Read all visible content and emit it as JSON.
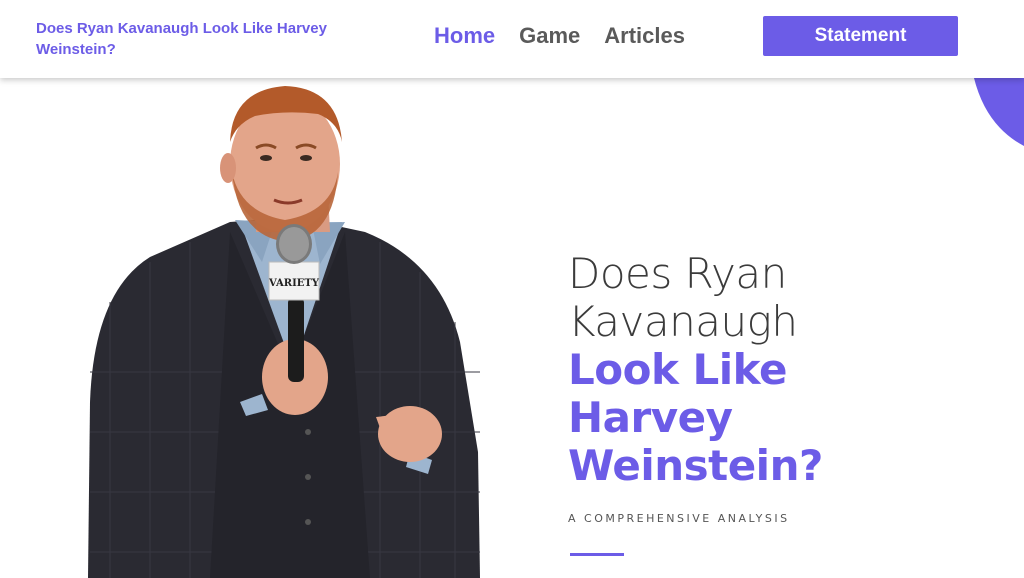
{
  "header": {
    "site_title": "Does Ryan Kavanaugh Look Like Harvey Weinstein?",
    "nav": [
      {
        "label": "Home",
        "active": true
      },
      {
        "label": "Game",
        "active": false
      },
      {
        "label": "Articles",
        "active": false
      }
    ],
    "cta_label": "Statement"
  },
  "hero": {
    "title_light": [
      "Does Ryan",
      "Kavanaugh"
    ],
    "title_bold": [
      "Look Like",
      "Harvey",
      "Weinstein?"
    ],
    "subtitle": "A COMPREHENSIVE ANALYSIS",
    "microphone_label": "VARIETY"
  },
  "colors": {
    "accent": "#6c5ce7",
    "nav_text": "#5a5a5a",
    "heading_light": "#3b3b3b",
    "background": "#ffffff"
  }
}
